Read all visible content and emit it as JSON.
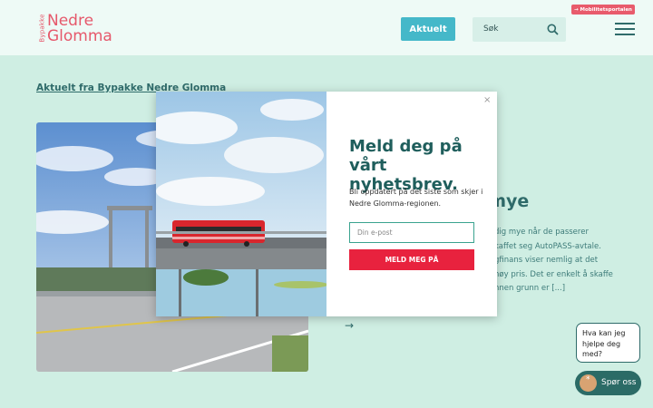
{
  "header": {
    "logo": {
      "small": "Bypakke",
      "line1": "Nedre",
      "line2": "Glomma"
    },
    "nav_button": "Aktuelt",
    "search_label": "Søk",
    "portal_button": "→ Mobilitetsportalen"
  },
  "main": {
    "section_heading": "Aktuelt fra Bypakke Nedre Glomma",
    "article": {
      "title_fragment": "g mye",
      "text_lines": [
        "dig mye når de passerer",
        "kaffet seg AutoPASS-avtale.",
        "gfinans viser nemlig at det",
        "høy pris. Det er enkelt å skaffe",
        "nnen grunn er [...]"
      ],
      "arrow": "→"
    }
  },
  "modal": {
    "close": "×",
    "title_line1": "Meld deg på",
    "title_line2": "vårt nyhetsbrev.",
    "description": "Bli oppdatert på det siste som skjer i Nedre Glomma-regionen.",
    "email_placeholder": "Din e-post",
    "submit_label": "MELD MEG PÅ"
  },
  "chat": {
    "bubble_text": "Hva kan jeg hjelpe deg med?",
    "button_label": "Spør oss"
  },
  "colors": {
    "background": "#cfeee3",
    "teal_dark": "#2f6b6a",
    "cta_red": "#e8223e",
    "accent_pink": "#e6586b",
    "button_blue": "#45b8c9"
  }
}
